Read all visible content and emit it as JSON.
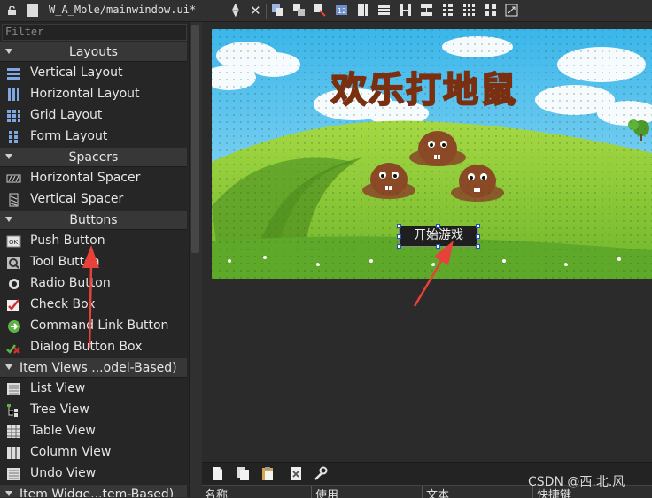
{
  "titlebar": {
    "document_title": "W_A_Mole/mainwindow.ui*"
  },
  "widget_box": {
    "filter_placeholder": "Filter",
    "categories": [
      {
        "label": "Layouts",
        "items": [
          "Vertical Layout",
          "Horizontal Layout",
          "Grid Layout",
          "Form Layout"
        ]
      },
      {
        "label": "Spacers",
        "items": [
          "Horizontal Spacer",
          "Vertical Spacer"
        ]
      },
      {
        "label": "Buttons",
        "items": [
          "Push Button",
          "Tool Button",
          "Radio Button",
          "Check Box",
          "Command Link Button",
          "Dialog Button Box"
        ]
      },
      {
        "label": "Item Views ...odel-Based)",
        "items": [
          "List View",
          "Tree View",
          "Table View",
          "Column View",
          "Undo View"
        ]
      },
      {
        "label": "Item Widge...tem-Based)",
        "items": []
      }
    ]
  },
  "form": {
    "game_title": "欢乐打地鼠",
    "start_button_label": "开始游戏"
  },
  "action_editor": {
    "columns": [
      "名称",
      "使用",
      "文本",
      "快捷键"
    ]
  },
  "watermark": "CSDN @西.北.风",
  "colors": {
    "accent_arrow": "#e8413a",
    "selection_handle": "#2050c0",
    "sky": "#5cc8ee",
    "grass": "#8fce3a"
  }
}
